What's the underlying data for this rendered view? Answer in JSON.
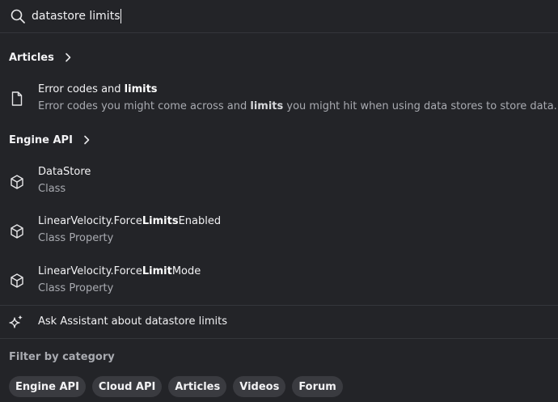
{
  "search": {
    "query": "datastore limits"
  },
  "articles_section": {
    "label": "Articles"
  },
  "articles": [
    {
      "icon": "document-icon",
      "title_parts": [
        {
          "t": "Error codes and ",
          "b": false
        },
        {
          "t": "limits",
          "b": true
        }
      ],
      "sub_parts": [
        {
          "t": "Error codes you might come across and ",
          "b": false
        },
        {
          "t": "limits",
          "b": true
        },
        {
          "t": " you might hit when using data stores to store data.",
          "b": false
        }
      ]
    }
  ],
  "engine_section": {
    "label": "Engine API"
  },
  "engine_results": [
    {
      "icon": "cube-icon",
      "title_parts": [
        {
          "t": "DataStore",
          "b": false
        }
      ],
      "sub": "Class"
    },
    {
      "icon": "cube-icon",
      "title_parts": [
        {
          "t": "LinearVelocity.Force",
          "b": false
        },
        {
          "t": "Limits",
          "b": true
        },
        {
          "t": "Enabled",
          "b": false
        }
      ],
      "sub": "Class Property"
    },
    {
      "icon": "cube-icon",
      "title_parts": [
        {
          "t": "LinearVelocity.Force",
          "b": false
        },
        {
          "t": "Limit",
          "b": true
        },
        {
          "t": "Mode",
          "b": false
        }
      ],
      "sub": "Class Property"
    }
  ],
  "assistant": {
    "label": "Ask Assistant about datastore limits",
    "icon": "sparkle-icon"
  },
  "filter": {
    "title": "Filter by category",
    "chips": [
      "Engine API",
      "Cloud API",
      "Articles",
      "Videos",
      "Forum"
    ]
  },
  "colors": {
    "background": "#232428",
    "chip": "#3a3b40",
    "muted_text": "#a9abb1"
  }
}
